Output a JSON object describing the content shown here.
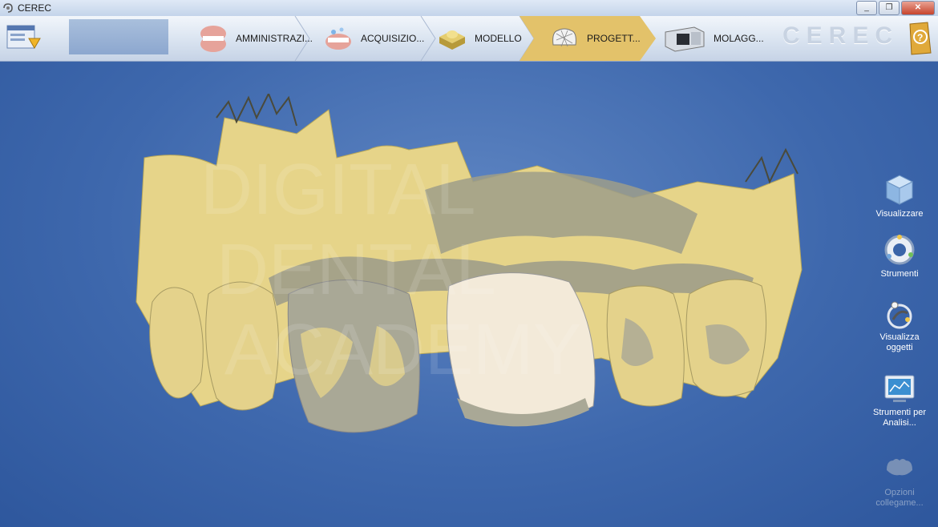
{
  "window": {
    "title": "CEREC"
  },
  "window_controls": {
    "minimize": "_",
    "restore": "❐",
    "close": "✕"
  },
  "toolbar": {
    "steps": [
      {
        "label": "AMMINISTRAZI...",
        "icon": "jaw-admin-icon",
        "active": false
      },
      {
        "label": "ACQUISIZIO...",
        "icon": "jaw-scan-icon",
        "active": false
      },
      {
        "label": "MODELLO",
        "icon": "model-icon",
        "active": false
      },
      {
        "label": "PROGETT...",
        "icon": "crown-design-icon",
        "active": true
      },
      {
        "label": "MOLAGG...",
        "icon": "milling-machine-icon",
        "active": false
      }
    ],
    "logo": "CEREC",
    "help_icon": "help-icon",
    "active_color": "#e3c26a"
  },
  "viewport": {
    "watermark": [
      "DIGITAL",
      "DENTAL",
      "ACADEMY"
    ]
  },
  "side_tools": [
    {
      "label": "Visualizzare",
      "icon": "cube-view-icon",
      "enabled": true
    },
    {
      "label": "Strumenti",
      "icon": "tools-ring-icon",
      "enabled": true
    },
    {
      "label": "Visualizza oggetti",
      "icon": "objects-view-icon",
      "enabled": true
    },
    {
      "label": "Strumenti per Analisi...",
      "icon": "analysis-monitor-icon",
      "enabled": true
    },
    {
      "label": "Opzioni collegame...",
      "icon": "connection-options-icon",
      "enabled": false
    }
  ]
}
